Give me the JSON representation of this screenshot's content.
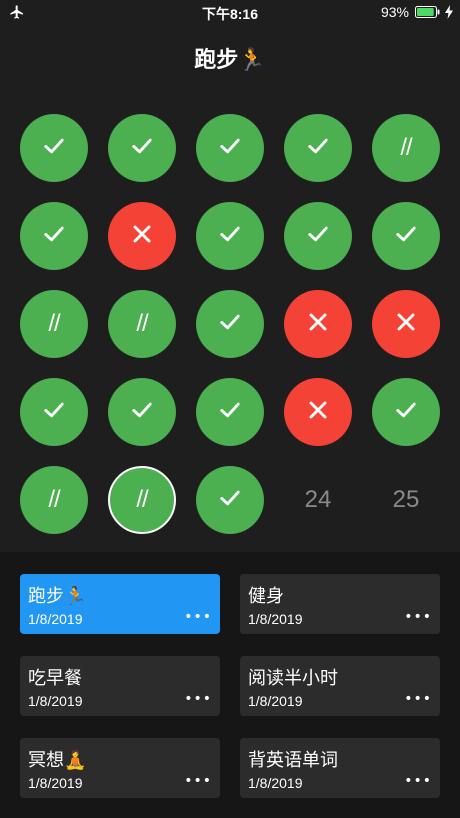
{
  "status_bar": {
    "time": "下午8:16",
    "battery_percent": "93%",
    "battery_level": 0.93
  },
  "title": "跑步🏃",
  "calendar": {
    "days": [
      {
        "state": "done"
      },
      {
        "state": "done"
      },
      {
        "state": "done"
      },
      {
        "state": "done"
      },
      {
        "state": "partial",
        "mark": "//"
      },
      {
        "state": "done"
      },
      {
        "state": "fail"
      },
      {
        "state": "done"
      },
      {
        "state": "done"
      },
      {
        "state": "done"
      },
      {
        "state": "partial",
        "mark": "//"
      },
      {
        "state": "partial",
        "mark": "//"
      },
      {
        "state": "done"
      },
      {
        "state": "fail"
      },
      {
        "state": "fail"
      },
      {
        "state": "done"
      },
      {
        "state": "done"
      },
      {
        "state": "done"
      },
      {
        "state": "fail"
      },
      {
        "state": "done"
      },
      {
        "state": "partial",
        "mark": "//"
      },
      {
        "state": "partial",
        "mark": "//",
        "current": true
      },
      {
        "state": "done"
      },
      {
        "state": "future",
        "label": "24"
      },
      {
        "state": "future",
        "label": "25"
      }
    ]
  },
  "habits": [
    {
      "name": "跑步🏃",
      "date": "1/8/2019",
      "more": "•••",
      "active": true
    },
    {
      "name": "健身",
      "date": "1/8/2019",
      "more": "•••"
    },
    {
      "name": "吃早餐",
      "date": "1/8/2019",
      "more": "•••"
    },
    {
      "name": "阅读半小时",
      "date": "1/8/2019",
      "more": "•••"
    },
    {
      "name": "冥想🧘",
      "date": "1/8/2019",
      "more": "•••"
    },
    {
      "name": "背英语单词",
      "date": "1/8/2019",
      "more": "•••"
    }
  ],
  "colors": {
    "done": "#4caf50",
    "fail": "#f44336",
    "active_card": "#2196f3",
    "battery": "#4cd964"
  },
  "icons": {
    "done": "check-icon",
    "fail": "cross-icon",
    "status_left": "airplane-icon",
    "charging": "bolt-icon"
  }
}
